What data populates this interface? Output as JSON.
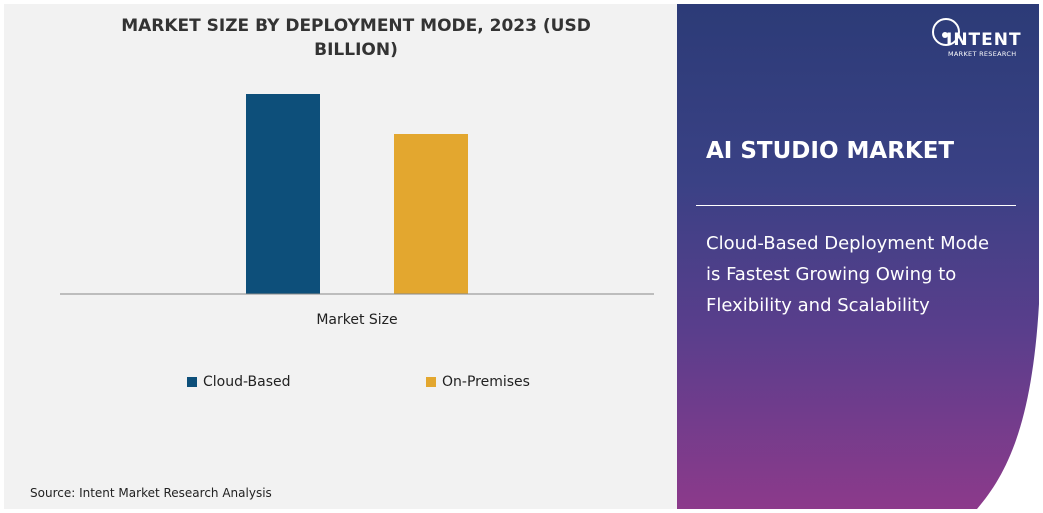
{
  "chart_data": {
    "type": "bar",
    "title": "MARKET SIZE BY DEPLOYMENT MODE, 2023 (USD BILLION)",
    "categories": [
      "Market Size"
    ],
    "series": [
      {
        "name": "Cloud-Based",
        "values": [
          1.0
        ],
        "color": "#0d4f7a"
      },
      {
        "name": "On-Premises",
        "values": [
          0.8
        ],
        "color": "#e3a72f"
      }
    ],
    "ylim": [
      0,
      1.1
    ],
    "grid": false,
    "legend_position": "bottom"
  },
  "source": "Source: Intent Market Research Analysis",
  "brand": {
    "logo_name": "INTENT",
    "logo_tagline": "MARKET RESEARCH"
  },
  "panel": {
    "market_title": "AI STUDIO MARKET",
    "headline": "Cloud-Based Deployment Mode is Fastest Growing Owing to Flexibility and Scalability"
  },
  "colors": {
    "panel_bg": "#f2f2f2",
    "right_top": "#2c3b77",
    "right_bottom": "#8c3a8b"
  }
}
